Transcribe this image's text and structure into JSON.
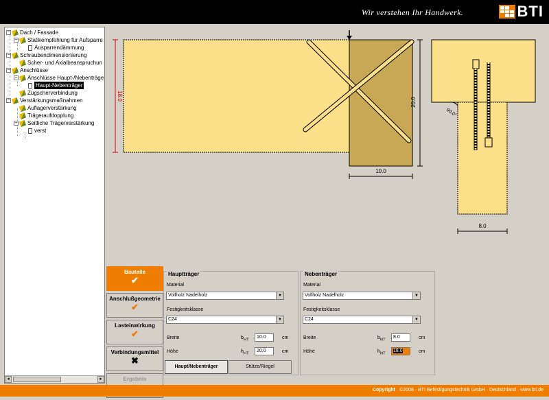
{
  "header": {
    "slogan": "Wir verstehen Ihr Handwerk.",
    "logo_text": "BTI"
  },
  "tree": {
    "items": [
      {
        "label": "Dach / Fassade",
        "type": "folder",
        "expander": "−"
      },
      {
        "label": "Statikempfehlung für Aufsparre",
        "type": "folder",
        "expander": "−"
      },
      {
        "label": "Ausparrendämmung",
        "type": "doc"
      },
      {
        "label": "Schraubendimensionierung",
        "type": "folder",
        "expander": "−"
      },
      {
        "label": "Scher- und Axialbeanspruchun",
        "type": "folder"
      },
      {
        "label": "Anschlüsse",
        "type": "folder",
        "expander": "−"
      },
      {
        "label": "Anschlüsse Haupt-/Nebenträge",
        "type": "folder",
        "expander": "−"
      },
      {
        "label": "Haupt-Nebenträger",
        "type": "doc",
        "selected": true
      },
      {
        "label": "Zugscherverbindung",
        "type": "folder"
      },
      {
        "label": "Verstärkungsmaßnahmen",
        "type": "folder",
        "expander": "−"
      },
      {
        "label": "Auflagerverstärkung",
        "type": "folder"
      },
      {
        "label": "Trägeraufdopplung",
        "type": "folder"
      },
      {
        "label": "Seitliche Trägerverstärkung",
        "type": "folder",
        "expander": "−"
      },
      {
        "label": "verst",
        "type": "doc"
      }
    ]
  },
  "drawing": {
    "dim_height_left": "18.0",
    "dim_height_right": "20.0",
    "dim_width_main": "10.0",
    "dim_width_section": "8.0",
    "angle": "90.0°",
    "wood_light": "#fde08a",
    "wood_dark": "#c8a855"
  },
  "tabs": [
    {
      "label": "Bauteile",
      "symbol": "✔",
      "state": "active"
    },
    {
      "label": "Anschlußgeometrie",
      "symbol": "✔",
      "state": "normal"
    },
    {
      "label": "Lasteinwirkung",
      "symbol": "✔",
      "state": "normal"
    },
    {
      "label": "Verbindungsmittel",
      "symbol": "✖",
      "state": "normal"
    },
    {
      "label": "Ergebnis",
      "symbol": "✔",
      "state": "disabled"
    }
  ],
  "haupttraeger": {
    "title": "Hauptträger",
    "material_label": "Material",
    "material_value": "Vollholz Nadelholz",
    "festigkeit_label": "Festigkeitsklasse",
    "festigkeit_value": "C24",
    "breite_label": "Breite",
    "breite_sym": "b",
    "breite_sub": "HT",
    "breite_value": "10.0",
    "breite_unit": "cm",
    "hoehe_label": "Höhe",
    "hoehe_sym": "h",
    "hoehe_sub": "HT",
    "hoehe_value": "20.0",
    "hoehe_unit": "cm"
  },
  "nebentraeger": {
    "title": "Nebenträger",
    "material_label": "Material",
    "material_value": "Vollholz Nadelholz",
    "festigkeit_label": "Festigkeitsklasse",
    "festigkeit_value": "C24",
    "breite_label": "Breite",
    "breite_sym": "b",
    "breite_sub": "NT",
    "breite_value": "8.0",
    "breite_unit": "cm",
    "hoehe_label": "Höhe",
    "hoehe_sym": "h",
    "hoehe_sub": "NT",
    "hoehe_value": "18.0",
    "hoehe_unit": "cm"
  },
  "buttons": {
    "haupt_neben": "Haupt/Nebenträger",
    "stuetze_riegel": "Stütze/Riegel"
  },
  "footer": {
    "copyright_label": "Copyright",
    "text": "· ©2008 · BTI Befestigungstechnik GmbH · Deutschland · www.bti.de"
  },
  "colors": {
    "accent": "#ef7d00"
  }
}
